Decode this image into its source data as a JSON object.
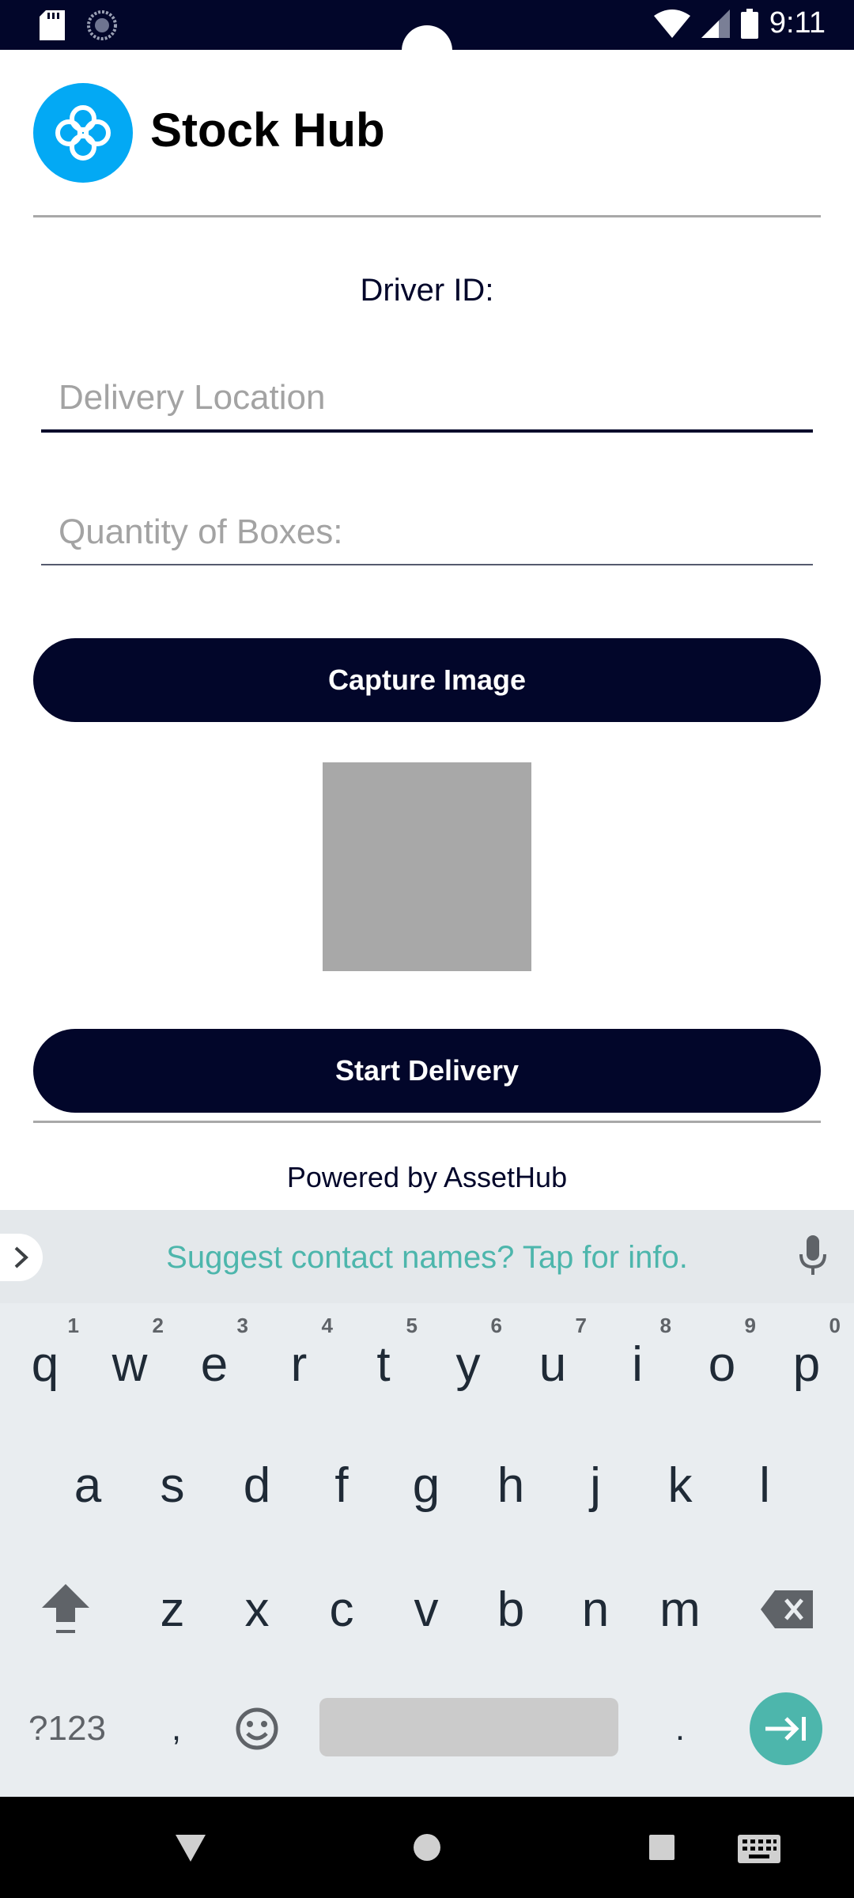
{
  "status_bar": {
    "time": "9:11"
  },
  "header": {
    "title": "Stock Hub"
  },
  "form": {
    "driver_id_label": "Driver ID:",
    "delivery_location_placeholder": "Delivery Location",
    "quantity_placeholder": "Quantity of Boxes:",
    "capture_image_label": "Capture Image",
    "start_delivery_label": "Start Delivery"
  },
  "footer": {
    "powered_by": "Powered by AssetHub"
  },
  "keyboard": {
    "suggestion": "Suggest contact names? Tap for info.",
    "row1": [
      "q",
      "w",
      "e",
      "r",
      "t",
      "y",
      "u",
      "i",
      "o",
      "p"
    ],
    "row1_hints": [
      "1",
      "2",
      "3",
      "4",
      "5",
      "6",
      "7",
      "8",
      "9",
      "0"
    ],
    "row2": [
      "a",
      "s",
      "d",
      "f",
      "g",
      "h",
      "j",
      "k",
      "l"
    ],
    "row3": [
      "z",
      "x",
      "c",
      "v",
      "b",
      "n",
      "m"
    ],
    "symbols_key": "?123",
    "comma_key": ",",
    "period_key": "."
  },
  "colors": {
    "navy": "#02062a",
    "brand_blue": "#03a9f4",
    "teal": "#4db6ac"
  }
}
